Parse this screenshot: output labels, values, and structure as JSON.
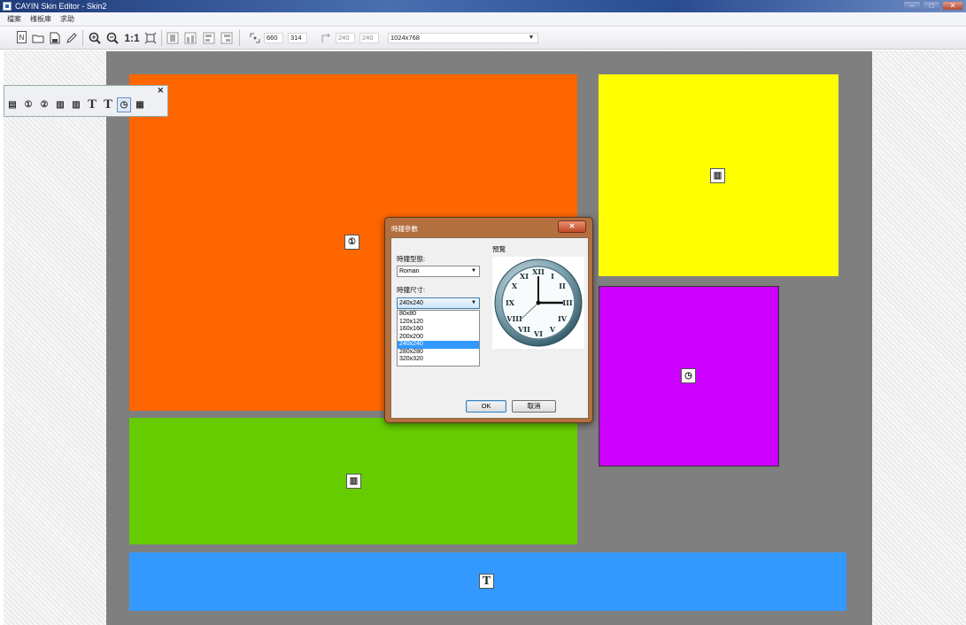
{
  "window": {
    "title": "CAYIN Skin Editor - Skin2",
    "min_glyph": "–",
    "max_glyph": "□",
    "close_glyph": "✕"
  },
  "menu": {
    "items": [
      {
        "label": "檔案"
      },
      {
        "label": "樣板庫"
      },
      {
        "label": "求助"
      }
    ]
  },
  "toolbar": {
    "new_glyph": "N",
    "zoom_reset_label": "1:1",
    "pos_x": "660",
    "pos_y": "314",
    "size_w": "240",
    "size_h": "240",
    "resolution": "1024x768"
  },
  "palette": {
    "close_glyph": "✕",
    "tools": [
      {
        "name": "layout-tool-icon",
        "glyph": "▤",
        "style": ""
      },
      {
        "name": "media-tool-1-icon",
        "glyph": "①",
        "style": ""
      },
      {
        "name": "media-tool-2-icon",
        "glyph": "②",
        "style": ""
      },
      {
        "name": "slideshow-tool-icon",
        "glyph": "▥",
        "style": ""
      },
      {
        "name": "slideshow-tool-2-icon",
        "glyph": "▥",
        "style": ""
      },
      {
        "name": "text-tool-icon",
        "glyph": "T",
        "style": "text"
      },
      {
        "name": "text-tool-2-icon",
        "glyph": "T",
        "style": "text"
      },
      {
        "name": "clock-tool-icon",
        "glyph": "◷",
        "style": "active"
      },
      {
        "name": "date-tool-icon",
        "glyph": "▦",
        "style": ""
      }
    ]
  },
  "zones": [
    {
      "name": "zone-video",
      "color": "#ff6600",
      "glyph": "①"
    },
    {
      "name": "zone-image-top",
      "color": "#ffff00",
      "glyph": "▥"
    },
    {
      "name": "zone-clock",
      "color": "#cc00ff",
      "glyph": "◷"
    },
    {
      "name": "zone-image-bottom",
      "color": "#66cc00",
      "glyph": "▥"
    },
    {
      "name": "zone-text",
      "color": "#3399ff",
      "glyph": "T"
    }
  ],
  "dialog": {
    "title": "時鐘參數",
    "close_glyph": "✕",
    "style_label": "時鐘型態:",
    "style_value": "Roman",
    "size_label": "時鐘尺寸:",
    "size_value": "240x240",
    "size_options": [
      "80x80",
      "120x120",
      "160x160",
      "200x200",
      "240x240",
      "280x280",
      "320x320"
    ],
    "selected_index": 4,
    "preview_label": "預覽",
    "ok_label": "OK",
    "cancel_label": "取消"
  }
}
